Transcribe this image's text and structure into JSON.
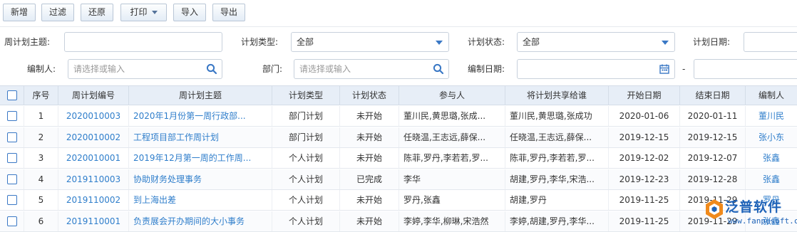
{
  "toolbar": {
    "new": "新增",
    "filter": "过滤",
    "reset": "还原",
    "print": "打印",
    "import": "导入",
    "export": "导出"
  },
  "filters": {
    "topic_label": "周计划主题:",
    "topic_value": "",
    "type_label": "计划类型:",
    "type_value": "全部",
    "status_label": "计划状态:",
    "status_value": "全部",
    "date_label": "计划日期:",
    "editor_label": "编制人:",
    "editor_placeholder": "请选择或输入",
    "dept_label": "部门:",
    "dept_placeholder": "请选择或输入",
    "edit_date_label": "编制日期:",
    "date_separator": "-"
  },
  "table": {
    "headers": [
      "序号",
      "周计划编号",
      "周计划主题",
      "计划类型",
      "计划状态",
      "参与人",
      "将计划共享给谁",
      "开始日期",
      "结束日期",
      "编制人"
    ],
    "rows": [
      {
        "no": "1",
        "code": "2020010003",
        "topic": "2020年1月份第一周行政部...",
        "type": "部门计划",
        "status": "未开始",
        "participants": "董川民,黄思璐,张成...",
        "shared": "董川民,黄思璐,张成功",
        "start": "2020-01-06",
        "end": "2020-01-11",
        "editor": "董川民"
      },
      {
        "no": "2",
        "code": "2020010002",
        "topic": "工程项目部工作周计划",
        "type": "部门计划",
        "status": "未开始",
        "participants": "任晓温,王志远,薛保...",
        "shared": "任晓温,王志远,薛保...",
        "start": "2019-12-15",
        "end": "2019-12-15",
        "editor": "张小东"
      },
      {
        "no": "3",
        "code": "2020010001",
        "topic": "2019年12月第一周的工作周...",
        "type": "个人计划",
        "status": "未开始",
        "participants": "陈菲,罗丹,李若若,罗...",
        "shared": "陈菲,罗丹,李若若,罗...",
        "start": "2019-12-02",
        "end": "2019-12-07",
        "editor": "张鑫"
      },
      {
        "no": "4",
        "code": "2019110003",
        "topic": "协助财务处理事务",
        "type": "个人计划",
        "status": "已完成",
        "participants": "李华",
        "shared": "胡建,罗丹,李华,宋浩...",
        "start": "2019-12-23",
        "end": "2019-12-28",
        "editor": "张鑫"
      },
      {
        "no": "5",
        "code": "2019110002",
        "topic": "到上海出差",
        "type": "个人计划",
        "status": "未开始",
        "participants": "罗丹,张鑫",
        "shared": "胡建,罗丹",
        "start": "2019-11-25",
        "end": "2019-11-29",
        "editor": "罗丹"
      },
      {
        "no": "6",
        "code": "2019110001",
        "topic": "负责展会开办期间的大小事务",
        "type": "个人计划",
        "status": "未开始",
        "participants": "李婷,李华,柳琳,宋浩然",
        "shared": "李婷,胡建,罗丹,李华...",
        "start": "2019-11-25",
        "end": "2019-11-29",
        "editor": "张鑫"
      }
    ]
  },
  "logo": {
    "name": "泛普软件",
    "sub": "www.fanpusoft.com"
  },
  "colors": {
    "link": "#2f7ecb",
    "accent": "#3a78c5",
    "header_bg": "#e7eef7"
  }
}
